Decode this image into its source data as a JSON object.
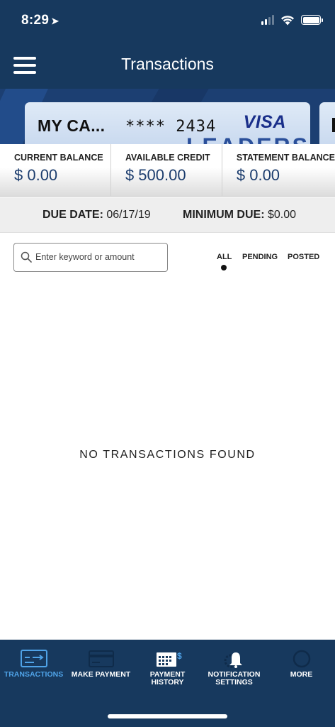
{
  "status_bar": {
    "time": "8:29",
    "location_glyph": "➤"
  },
  "header": {
    "title": "Transactions",
    "menu_icon": "hamburger-menu-icon"
  },
  "card": {
    "name": "MY CA...",
    "number": "**** 2434",
    "brand": "VISA",
    "watermark": "LEADERS"
  },
  "balances": [
    {
      "label": "CURRENT BALANCE",
      "value": "$ 0.00"
    },
    {
      "label": "AVAILABLE CREDIT",
      "value": "$ 500.00"
    },
    {
      "label": "STATEMENT BALANCE",
      "value": "$ 0.00"
    }
  ],
  "due": {
    "date_label": "DUE DATE:",
    "date_value": "06/17/19",
    "min_label": "MINIMUM DUE:",
    "min_value": "$0.00"
  },
  "search": {
    "placeholder": "Enter keyword or amount",
    "value": ""
  },
  "filters": {
    "tabs": [
      "ALL",
      "PENDING",
      "POSTED"
    ],
    "selected": "ALL"
  },
  "empty_message": "NO TRANSACTIONS FOUND",
  "nav": {
    "items": [
      {
        "label_line1": "TRANSACTIONS",
        "label_line2": "",
        "icon": "transactions-card-icon",
        "active": true
      },
      {
        "label_line1": "MAKE PAYMENT",
        "label_line2": "",
        "icon": "payment-card-icon",
        "active": false
      },
      {
        "label_line1": "PAYMENT",
        "label_line2": "HISTORY",
        "icon": "calendar-dollar-icon",
        "active": false
      },
      {
        "label_line1": "NOTIFICATION",
        "label_line2": "SETTINGS",
        "icon": "bell-gear-icon",
        "active": false
      },
      {
        "label_line1": "MORE",
        "label_line2": "",
        "icon": "more-circle-icon",
        "active": false
      }
    ]
  },
  "colors": {
    "header_bg": "#17395e",
    "accent_active": "#4fa3e8",
    "balance_value": "#1c3d6e"
  }
}
